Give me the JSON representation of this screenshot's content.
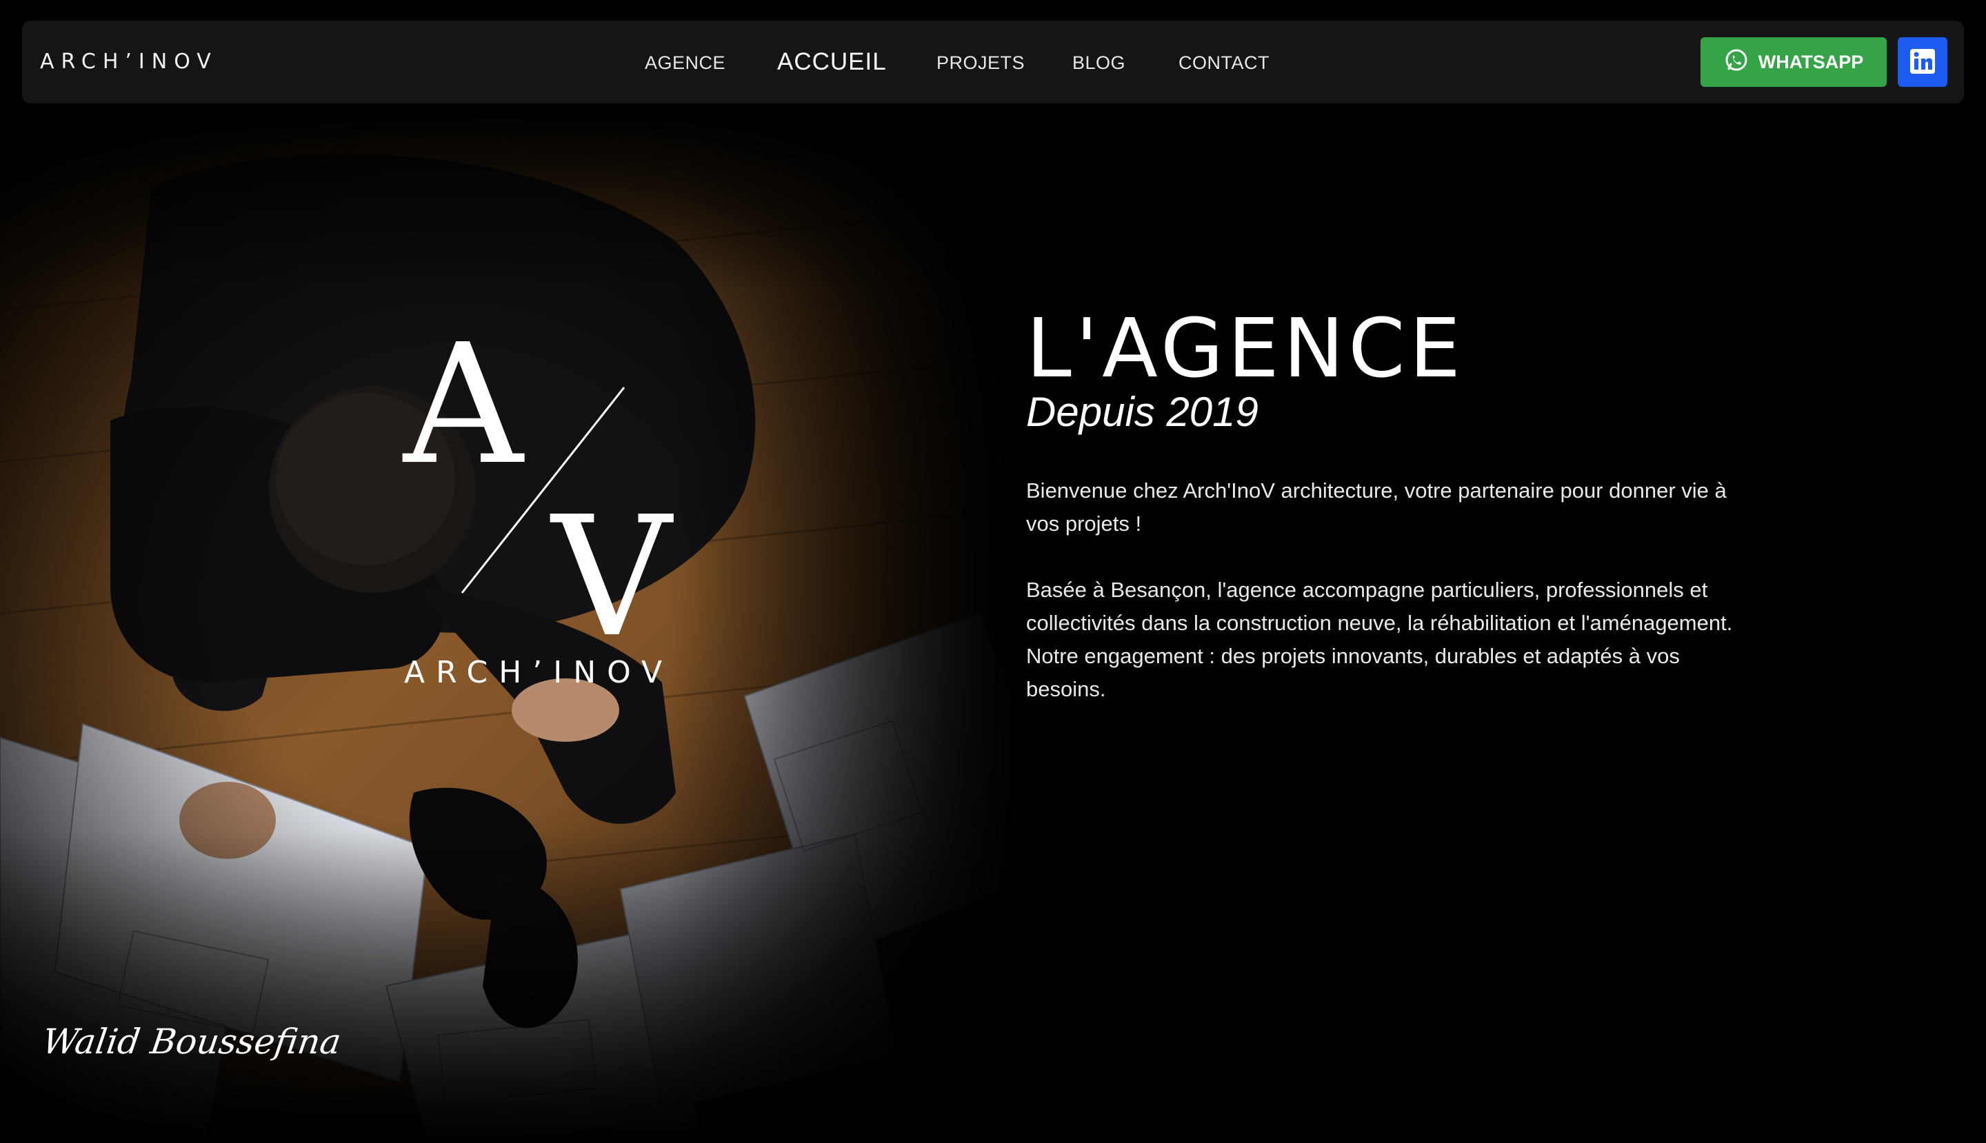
{
  "header": {
    "brand": "ARCH’INOV",
    "nav": [
      {
        "label": "AGENCE"
      },
      {
        "label": "ACCUEIL",
        "active": true
      },
      {
        "label": "PROJETS"
      },
      {
        "label": "BLOG"
      },
      {
        "label": "CONTACT"
      }
    ],
    "whatsapp_label": "WHATSAPP",
    "whatsapp_icon": "whatsapp-icon",
    "linkedin_icon": "linkedin-icon",
    "colors": {
      "whatsapp": "#35a447",
      "linkedin": "#1e5bf0",
      "navbar": "#151517"
    }
  },
  "hero": {
    "logo_letters": {
      "top": "A",
      "bottom": "V"
    },
    "logo_wordmark": "ARCH’INOV",
    "signature": "Walid Boussefina"
  },
  "content": {
    "title": "L'AGENCE",
    "subtitle": "Depuis 2019",
    "paragraphs": [
      "Bienvenue chez Arch'InoV architecture, votre partenaire pour donner vie à vos projets !",
      "Basée à Besançon, l'agence accompagne particuliers, professionnels et collectivités dans la construction neuve, la réhabilitation et l'aménagement. Notre engagement : des projets innovants, durables et adaptés à vos besoins."
    ]
  }
}
